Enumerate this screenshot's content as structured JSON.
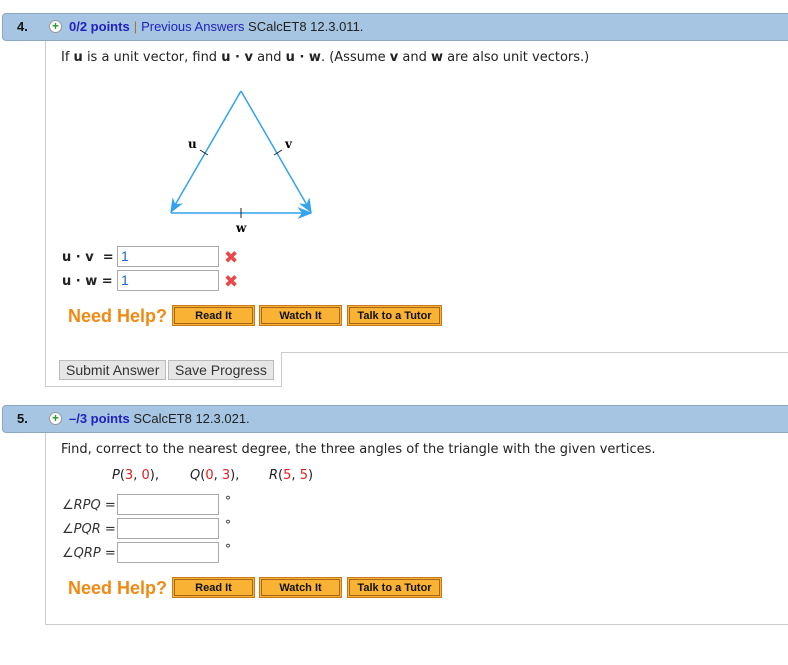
{
  "q4": {
    "number": "4.",
    "points": "0/2 points",
    "separator": "|",
    "previous_answers": "Previous Answers",
    "code": "SCalcET8 12.3.011.",
    "prompt_parts": [
      "If ",
      "u",
      " is a unit vector, find ",
      "u · v",
      " and ",
      "u · w",
      ". (Assume ",
      "v",
      " and ",
      "w",
      " are also unit vectors.)"
    ],
    "figure_labels": {
      "u": "u",
      "v": "v",
      "w": "w"
    },
    "answers": [
      {
        "label": "u · v  =",
        "value": "1",
        "status": "incorrect"
      },
      {
        "label": "u · w =",
        "value": "1",
        "status": "incorrect"
      }
    ],
    "need_help": "Need Help?",
    "help_buttons": [
      "Read It",
      "Watch It",
      "Talk to a Tutor"
    ],
    "submit": "Submit Answer",
    "save": "Save Progress"
  },
  "q5": {
    "number": "5.",
    "points": "–/3 points",
    "code": "SCalcET8 12.3.021.",
    "prompt": "Find, correct to the nearest degree, the three angles of the triangle with the given vertices.",
    "vertices": [
      {
        "name": "P",
        "a": "3",
        "b": "0",
        "sep": ",",
        "trail": ","
      },
      {
        "name": "Q",
        "a": "0",
        "b": "3",
        "sep": ",",
        "trail": ","
      },
      {
        "name": "R",
        "a": "5",
        "b": "5",
        "sep": ",",
        "trail": ""
      }
    ],
    "angles": [
      {
        "label": "∠RPQ =",
        "value": ""
      },
      {
        "label": "∠PQR =",
        "value": ""
      },
      {
        "label": "∠QRP =",
        "value": ""
      }
    ],
    "degree": "°",
    "need_help": "Need Help?",
    "help_buttons": [
      "Read It",
      "Watch It",
      "Talk to a Tutor"
    ]
  },
  "icons": {
    "incorrect": "✖",
    "plus": "+"
  },
  "colors": {
    "header": "#a6c5e2",
    "help": "#f08a12",
    "arrow": "#33a3ee"
  }
}
